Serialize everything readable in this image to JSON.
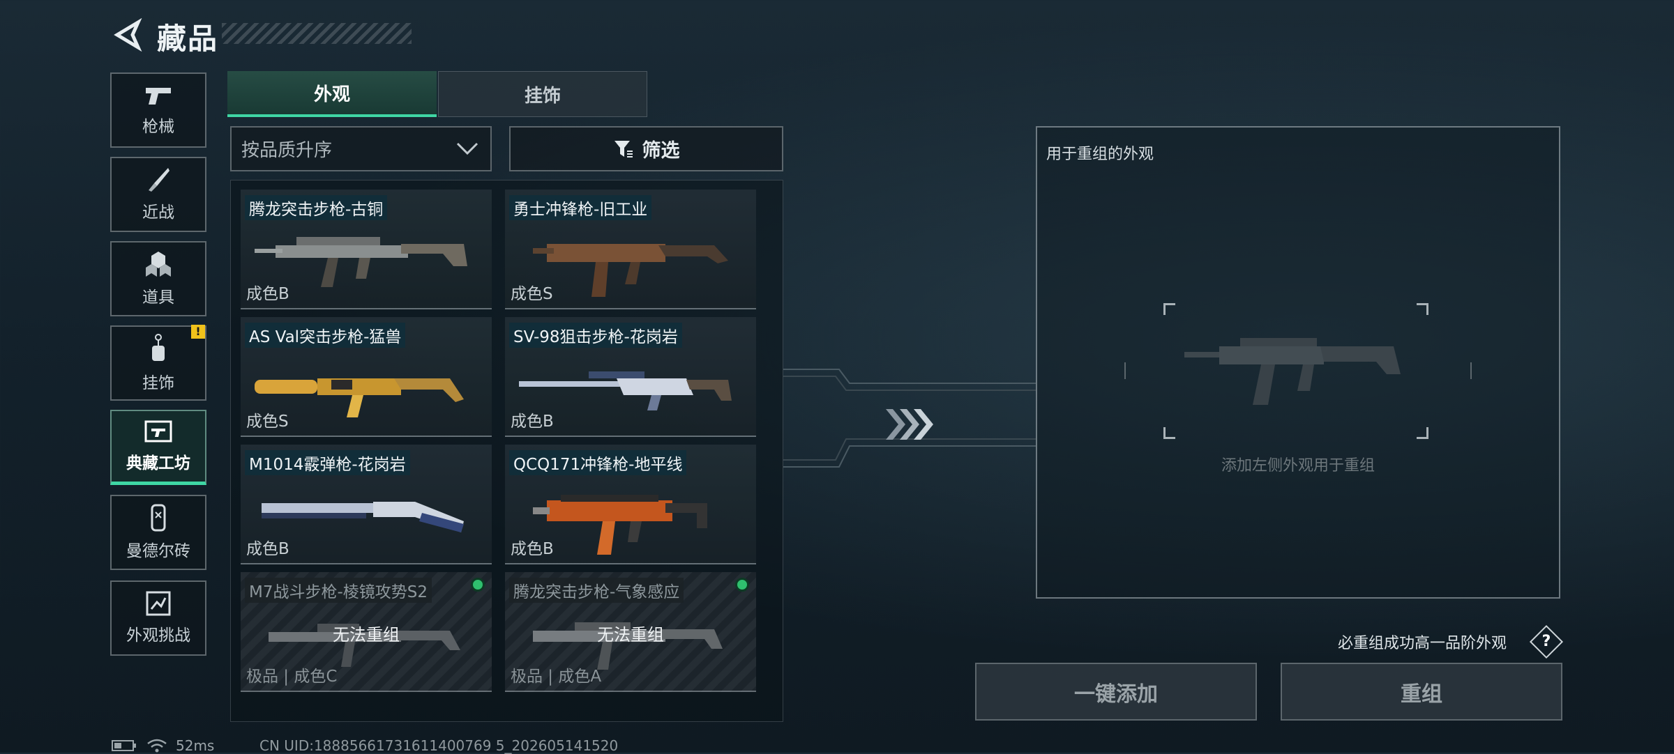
{
  "header": {
    "title": "藏品"
  },
  "nav": [
    {
      "label": "枪械",
      "icon": "pistol-icon"
    },
    {
      "label": "近战",
      "icon": "knife-icon"
    },
    {
      "label": "道具",
      "icon": "grenade-icon"
    },
    {
      "label": "挂饰",
      "icon": "charm-icon",
      "badge": "!"
    },
    {
      "label": "典藏工坊",
      "icon": "workshop-icon",
      "active": true
    },
    {
      "label": "曼德尔砖",
      "icon": "brick-icon"
    },
    {
      "label": "外观挑战",
      "icon": "challenge-icon"
    }
  ],
  "tabs": [
    {
      "label": "外观",
      "active": true
    },
    {
      "label": "挂饰",
      "active": false
    }
  ],
  "sort": {
    "label": "按品质升序"
  },
  "filter": {
    "label": "筛选"
  },
  "items": [
    {
      "name": "腾龙突击步枪-古铜",
      "grade": "成色B"
    },
    {
      "name": "勇士冲锋枪-旧工业",
      "grade": "成色S"
    },
    {
      "name": "AS Val突击步枪-猛兽",
      "grade": "成色S"
    },
    {
      "name": "SV-98狙击步枪-花岗岩",
      "grade": "成色B"
    },
    {
      "name": "M1014霰弹枪-花岗岩",
      "grade": "成色B"
    },
    {
      "name": "QCQ171冲锋枪-地平线",
      "grade": "成色B"
    },
    {
      "name": "M7战斗步枪-棱镜攻势S2",
      "grade": "极品 | 成色C",
      "locked_text": "无法重组"
    },
    {
      "name": "腾龙突击步枪-气象感应",
      "grade": "极品 | 成色A",
      "locked_text": "无法重组"
    }
  ],
  "recombine": {
    "title": "用于重组的外观",
    "hint": "添加左侧外观用于重组",
    "note": "必重组成功高一品阶外观",
    "help": "?",
    "add_all_label": "一键添加",
    "recombine_label": "重组"
  },
  "status": {
    "ping": "52ms",
    "uid": "CN UID:18885661731611400769 5_202605141520"
  },
  "colors": {
    "accent": "#3fd6a4",
    "badge": "#f1c21b",
    "equipped_dot": "#2fbf6e"
  }
}
